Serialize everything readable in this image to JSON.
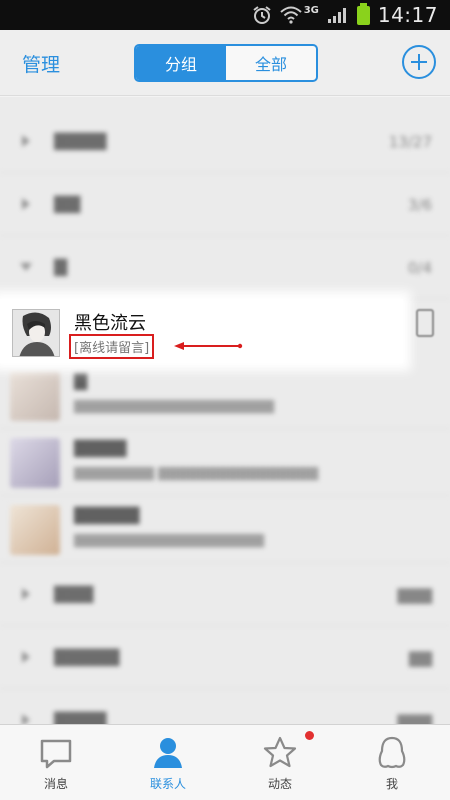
{
  "status_bar": {
    "network": "3G",
    "time": "14:17"
  },
  "header": {
    "manage_label": "管理",
    "tabs": [
      {
        "label": "分组",
        "active": true
      },
      {
        "label": "全部",
        "active": false
      }
    ],
    "accent_color": "#2a8fde"
  },
  "groups": [
    {
      "count": "13/27"
    },
    {
      "count": "3/6"
    },
    {
      "count": "0/4"
    }
  ],
  "highlight_contact": {
    "name": "黑色流云",
    "status": "[离线请留言]",
    "annotation_color": "#d91e1e"
  },
  "bottom_nav": [
    {
      "label": "消息",
      "icon": "message-icon"
    },
    {
      "label": "联系人",
      "icon": "contacts-icon",
      "active": true
    },
    {
      "label": "动态",
      "icon": "star-icon"
    },
    {
      "label": "我",
      "icon": "penguin-icon"
    }
  ]
}
